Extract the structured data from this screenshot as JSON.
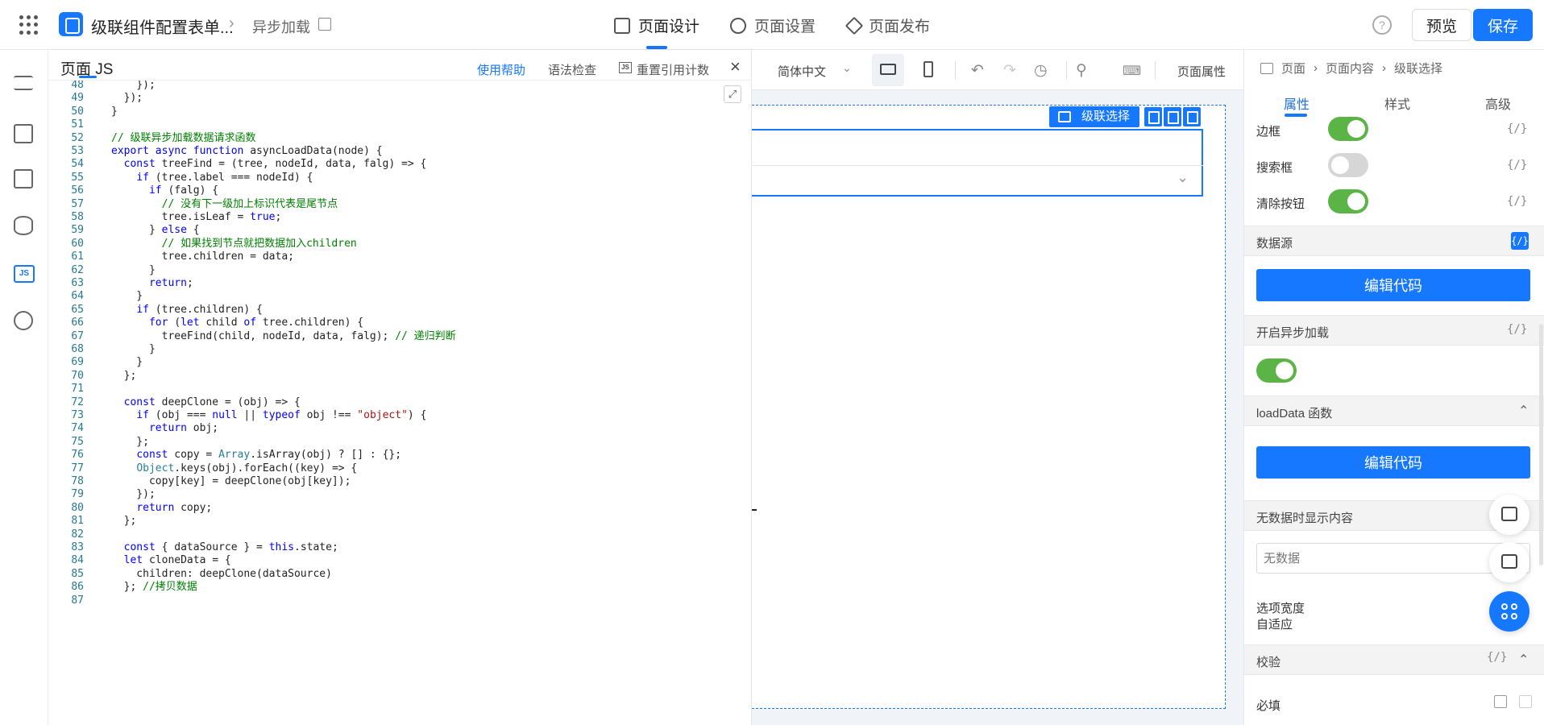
{
  "app": {
    "title": "级联组件配置表单...",
    "subtitle": "异步加载",
    "tabs": [
      {
        "label": "页面设计",
        "icon": "layout-icon",
        "active": true
      },
      {
        "label": "页面设置",
        "icon": "gear-icon",
        "active": false
      },
      {
        "label": "页面发布",
        "icon": "send-icon",
        "active": false
      }
    ],
    "preview_label": "预览",
    "save_label": "保存",
    "accent_color": "#1677ff"
  },
  "rail": {
    "items": [
      "outline-icon",
      "components-icon",
      "layout-blocks-icon",
      "datasource-icon",
      "js-icon",
      "globe-icon"
    ],
    "js_badge": "JS"
  },
  "js_panel": {
    "title": "页面 JS",
    "help": "使用帮助",
    "check": "语法检查",
    "reset": "重置引用计数",
    "reset_badge": "JS",
    "close": "×",
    "lines": [
      {
        "n": "48",
        "code": "    });"
      },
      {
        "n": "49",
        "code": "  });"
      },
      {
        "n": "50",
        "code": "}"
      },
      {
        "n": "51",
        "code": ""
      },
      {
        "n": "52",
        "code": "// 级联异步加载数据请求函数"
      },
      {
        "n": "53",
        "code": "export async function asyncLoadData(node) {"
      },
      {
        "n": "54",
        "code": "  const treeFind = (tree, nodeId, data, falg) => {"
      },
      {
        "n": "55",
        "code": "    if (tree.label === nodeId) {"
      },
      {
        "n": "56",
        "code": "      if (falg) {"
      },
      {
        "n": "57",
        "code": "        // 没有下一级加上标识代表是尾节点"
      },
      {
        "n": "58",
        "code": "        tree.isLeaf = true;"
      },
      {
        "n": "59",
        "code": "      } else {"
      },
      {
        "n": "60",
        "code": "        // 如果找到节点就把数据加入children"
      },
      {
        "n": "61",
        "code": "        tree.children = data;"
      },
      {
        "n": "62",
        "code": "      }"
      },
      {
        "n": "63",
        "code": "      return;"
      },
      {
        "n": "64",
        "code": "    }"
      },
      {
        "n": "65",
        "code": "    if (tree.children) {"
      },
      {
        "n": "66",
        "code": "      for (let child of tree.children) {"
      },
      {
        "n": "67",
        "code": "        treeFind(child, nodeId, data, falg); // 递归判断"
      },
      {
        "n": "68",
        "code": "      }"
      },
      {
        "n": "69",
        "code": "    }"
      },
      {
        "n": "70",
        "code": "  };"
      },
      {
        "n": "71",
        "code": ""
      },
      {
        "n": "72",
        "code": "  const deepClone = (obj) => {"
      },
      {
        "n": "73",
        "code": "    if (obj === null || typeof obj !== \"object\") {"
      },
      {
        "n": "74",
        "code": "      return obj;"
      },
      {
        "n": "75",
        "code": "    };"
      },
      {
        "n": "76",
        "code": "    const copy = Array.isArray(obj) ? [] : {};"
      },
      {
        "n": "77",
        "code": "    Object.keys(obj).forEach((key) => {"
      },
      {
        "n": "78",
        "code": "      copy[key] = deepClone(obj[key]);"
      },
      {
        "n": "79",
        "code": "    });"
      },
      {
        "n": "80",
        "code": "    return copy;"
      },
      {
        "n": "81",
        "code": "  };"
      },
      {
        "n": "82",
        "code": ""
      },
      {
        "n": "83",
        "code": "  const { dataSource } = this.state;"
      },
      {
        "n": "84",
        "code": "  let cloneData = {"
      },
      {
        "n": "85",
        "code": "    children: deepClone(dataSource)"
      },
      {
        "n": "86",
        "code": "  }; //拷贝数据"
      },
      {
        "n": "87",
        "code": ""
      }
    ]
  },
  "canvas_toolbar": {
    "language": "简体中文",
    "page_props": "页面属性"
  },
  "canvas": {
    "cascade_tag": "级联选择"
  },
  "right_panel": {
    "crumbs": [
      "页面",
      "页面内容",
      "级联选择"
    ],
    "tabs": [
      "属性",
      "样式",
      "高级"
    ],
    "border_label": "边框",
    "search_label": "搜索框",
    "clear_label": "清除按钮",
    "code_toggle": "{/}",
    "datasource_label": "数据源",
    "edit_code": "编辑代码",
    "async_label": "开启异步加载",
    "loaddata_label": "loadData 函数",
    "empty_label": "无数据时显示内容",
    "empty_value": "无数据",
    "width_label_1": "选项宽度",
    "width_label_2": "自适应",
    "validate_label": "校验",
    "required_label": "必填",
    "toggles": {
      "border": true,
      "search": false,
      "clear": true,
      "async": true
    }
  }
}
